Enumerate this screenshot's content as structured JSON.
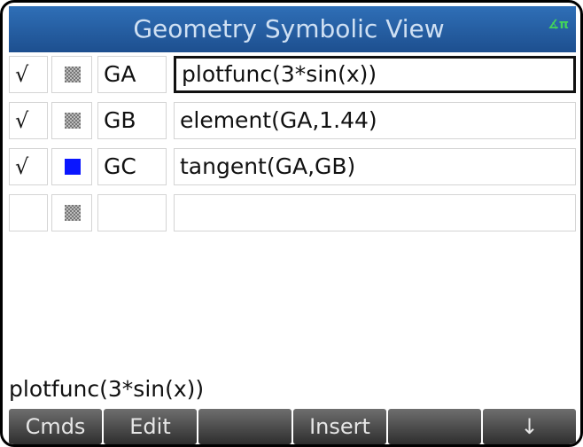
{
  "header": {
    "title": "Geometry Symbolic View",
    "angle_indicator": "∡π",
    "bg_color": "#2f6fb7"
  },
  "rows": [
    {
      "checked": true,
      "check_glyph": "√",
      "color": "dither",
      "name": "GA",
      "expression": "plotfunc(3*sin(x))",
      "selected": true
    },
    {
      "checked": true,
      "check_glyph": "√",
      "color": "dither",
      "name": "GB",
      "expression": "element(GA,1.44)",
      "selected": false
    },
    {
      "checked": true,
      "check_glyph": "√",
      "color": "#0a16ff",
      "name": "GC",
      "expression": "tangent(GA,GB)",
      "selected": false
    },
    {
      "checked": false,
      "check_glyph": "",
      "color": "dither",
      "name": "",
      "expression": "",
      "selected": false
    }
  ],
  "command_line": "plotfunc(3*sin(x))",
  "softkeys": [
    {
      "label": "Cmds"
    },
    {
      "label": "Edit"
    },
    {
      "label": ""
    },
    {
      "label": "Insert"
    },
    {
      "label": ""
    },
    {
      "label": "↓"
    }
  ]
}
